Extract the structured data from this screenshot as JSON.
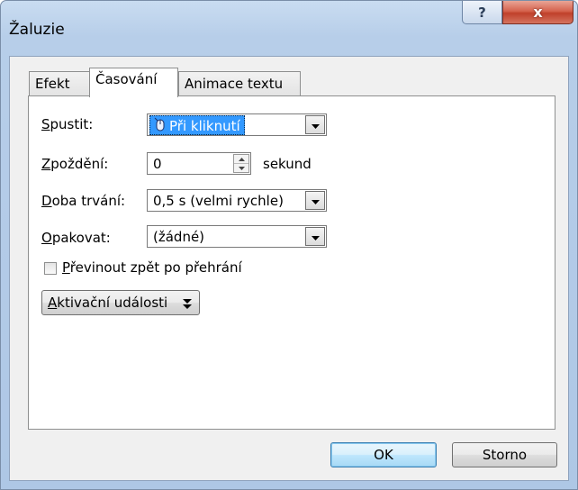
{
  "window": {
    "title": "Žaluzie",
    "help_glyph": "?",
    "close_glyph": "x"
  },
  "tabs": [
    {
      "label": "Efekt",
      "active": false
    },
    {
      "label": "Časování",
      "active": true
    },
    {
      "label": "Animace textu",
      "active": false
    }
  ],
  "timing": {
    "start": {
      "label": "Spustit:",
      "value": "Při kliknutí",
      "icon": "mouse-click-icon"
    },
    "delay": {
      "label": "Zpoždění:",
      "value": "0",
      "unit": "sekund"
    },
    "duration": {
      "label": "Doba trvání:",
      "value": "0,5 s (velmi rychle)"
    },
    "repeat": {
      "label": "Opakovat:",
      "value": "(žádné)"
    },
    "rewind": {
      "label": "Převinout zpět po přehrání",
      "checked": false
    },
    "triggers_button": "Aktivační události"
  },
  "footer": {
    "ok_label": "OK",
    "cancel_label": "Storno"
  }
}
